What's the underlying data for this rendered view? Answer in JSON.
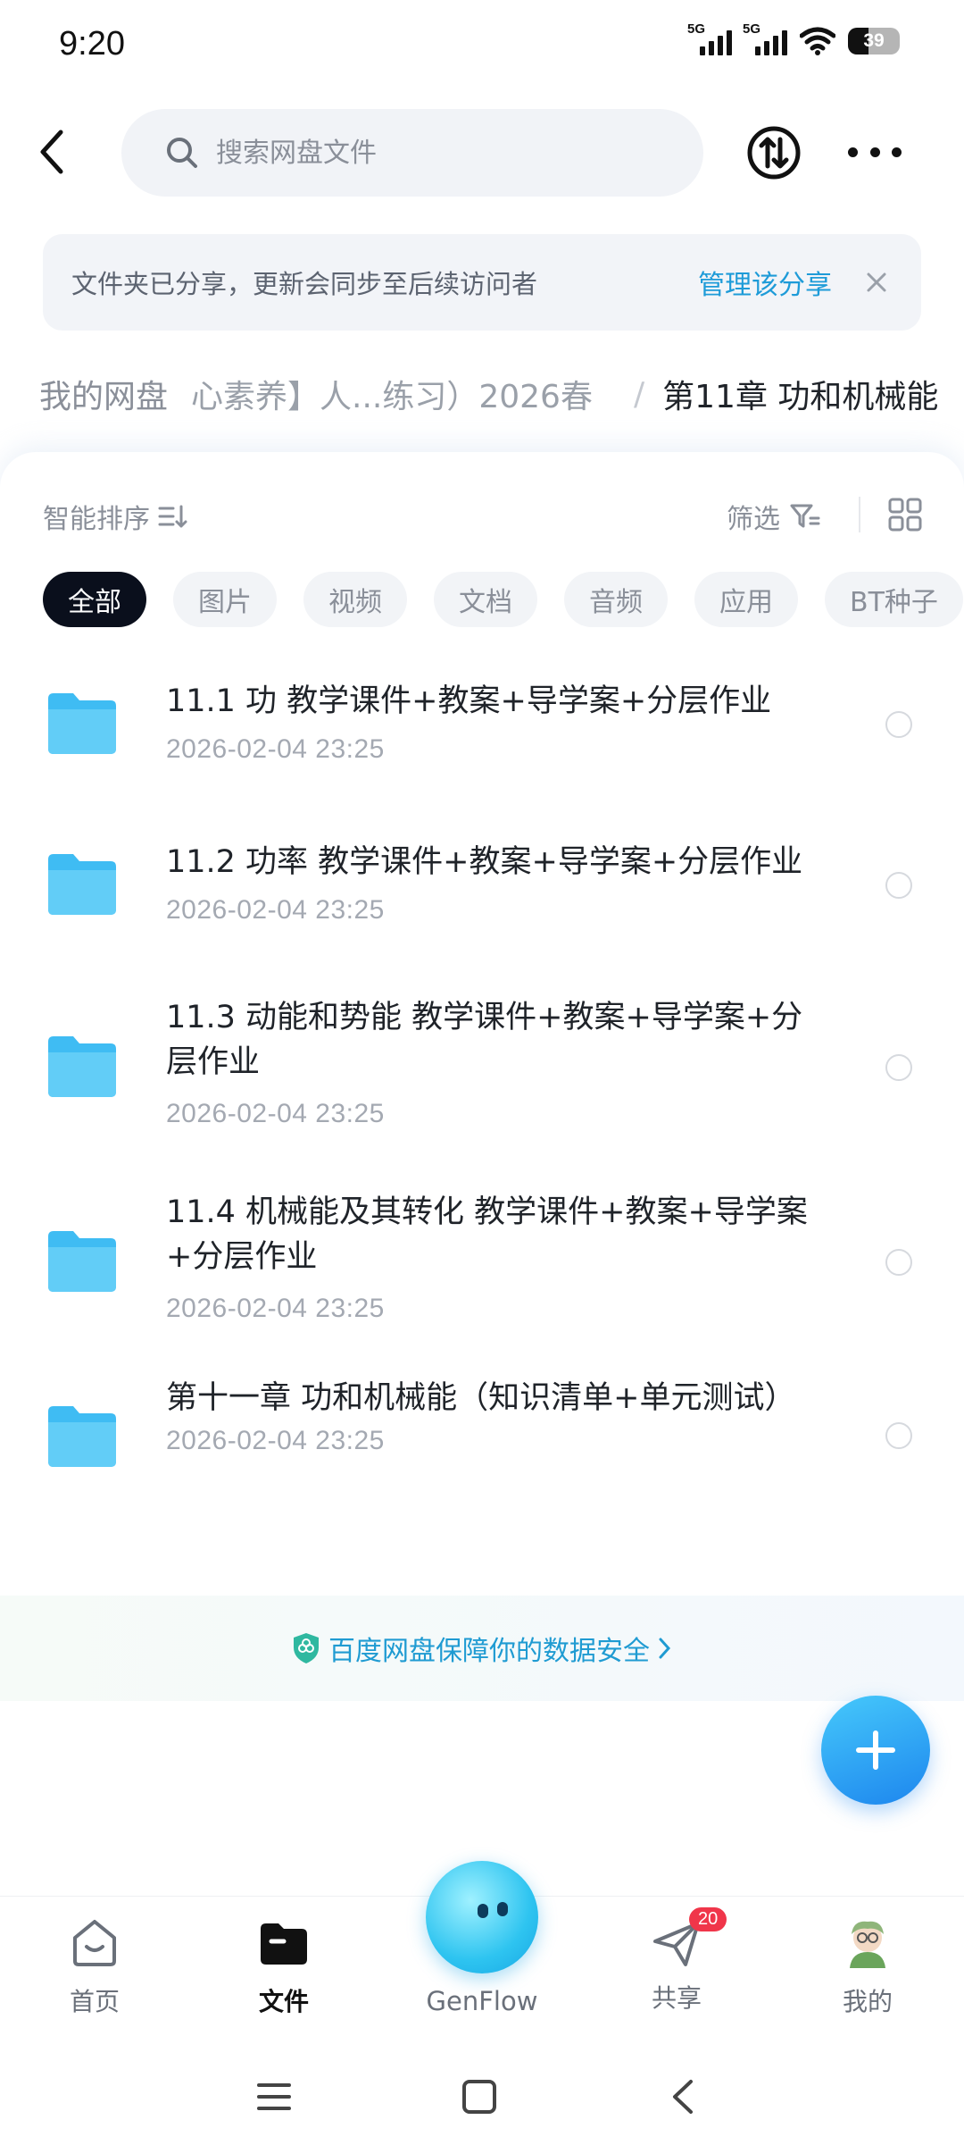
{
  "status_bar": {
    "time": "9:20",
    "signal1_label": "5G",
    "signal2_label": "5G",
    "battery": "39",
    "battery_level": 0.39
  },
  "header": {
    "search_placeholder": "搜索网盘文件"
  },
  "share_banner": {
    "message": "文件夹已分享，更新会同步至后续访问者",
    "manage_label": "管理该分享"
  },
  "breadcrumb": {
    "home": "我的网盘",
    "middle": "心素养】人...练习）2026春",
    "separator": "/",
    "current": "第11章 功和机械能"
  },
  "toolbar": {
    "sort_label": "智能排序",
    "filter_label": "筛选"
  },
  "chips": [
    "全部",
    "图片",
    "视频",
    "文档",
    "音频",
    "应用",
    "BT种子"
  ],
  "files": [
    {
      "name": "11.1 功 教学课件+教案+导学案+分层作业",
      "date": "2026-02-04  23:25"
    },
    {
      "name": "11.2 功率 教学课件+教案+导学案+分层作业",
      "date": "2026-02-04  23:25"
    },
    {
      "name": "11.3 动能和势能 教学课件+教案+导学案+分层作业",
      "date": "2026-02-04  23:25"
    },
    {
      "name": "11.4 机械能及其转化 教学课件+教案+导学案+分层作业",
      "date": "2026-02-04  23:25"
    },
    {
      "name": "第十一章 功和机械能（知识清单+单元测试）",
      "date": "2026-02-04  23:25"
    }
  ],
  "security": {
    "text": "百度网盘保障你的数据安全"
  },
  "bottom_nav": {
    "items": [
      {
        "label": "首页",
        "icon": "home-icon"
      },
      {
        "label": "文件",
        "icon": "folder-icon"
      },
      {
        "label": "GenFlow",
        "icon": "genflow-icon"
      },
      {
        "label": "共享",
        "icon": "send-icon",
        "badge": "20"
      },
      {
        "label": "我的",
        "icon": "avatar-icon"
      }
    ]
  },
  "colors": {
    "accent": "#1e9bd8",
    "folder": "#3fbcf3",
    "chip_active": "#0a0f1c",
    "badge": "#f0364a"
  }
}
